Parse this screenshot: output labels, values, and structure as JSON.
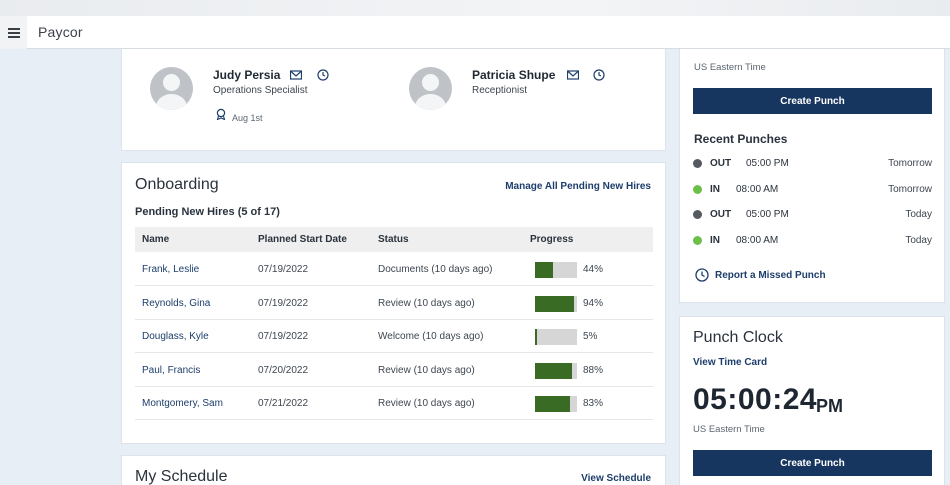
{
  "app": {
    "logo": "Paycor"
  },
  "people": [
    {
      "name": "Judy Persia",
      "role": "Operations Specialist",
      "anniversary": "Aug 1st"
    },
    {
      "name": "Patricia Shupe",
      "role": "Receptionist"
    }
  ],
  "onboarding": {
    "title": "Onboarding",
    "manage_link": "Manage All Pending New Hires",
    "subtitle": "Pending New Hires (5 of 17)",
    "columns": [
      "Name",
      "Planned Start Date",
      "Status",
      "Progress"
    ],
    "rows": [
      {
        "name": "Frank, Leslie",
        "date": "07/19/2022",
        "status": "Documents (10 days ago)",
        "progress": 44,
        "progress_label": "44%"
      },
      {
        "name": "Reynolds, Gina",
        "date": "07/19/2022",
        "status": "Review (10 days ago)",
        "progress": 94,
        "progress_label": "94%"
      },
      {
        "name": "Douglass, Kyle",
        "date": "07/19/2022",
        "status": "Welcome (10 days ago)",
        "progress": 5,
        "progress_label": "5%"
      },
      {
        "name": "Paul, Francis",
        "date": "07/20/2022",
        "status": "Review (10 days ago)",
        "progress": 88,
        "progress_label": "88%"
      },
      {
        "name": "Montgomery, Sam",
        "date": "07/21/2022",
        "status": "Review (10 days ago)",
        "progress": 83,
        "progress_label": "83%"
      }
    ]
  },
  "schedule": {
    "title": "My Schedule",
    "link": "View Schedule"
  },
  "punch_panel": {
    "timezone": "US Eastern Time",
    "create_label": "Create Punch",
    "recent_title": "Recent Punches",
    "punches": [
      {
        "kind": "OUT",
        "time": "05:00 PM",
        "day": "Tomorrow",
        "color": "#555a60"
      },
      {
        "kind": "IN",
        "time": "08:00 AM",
        "day": "Tomorrow",
        "color": "#6cc04a"
      },
      {
        "kind": "OUT",
        "time": "05:00 PM",
        "day": "Today",
        "color": "#555a60"
      },
      {
        "kind": "IN",
        "time": "08:00 AM",
        "day": "Today",
        "color": "#6cc04a"
      }
    ],
    "missed_label": "Report a Missed Punch"
  },
  "punch_clock": {
    "title": "Punch Clock",
    "view_link": "View Time Card",
    "time": "05:00:24",
    "ampm": "PM",
    "timezone": "US Eastern Time",
    "create_label": "Create Punch"
  },
  "colors": {
    "primary": "#17365f",
    "progress": "#3a6b25",
    "in": "#6cc04a",
    "out": "#555a60"
  }
}
